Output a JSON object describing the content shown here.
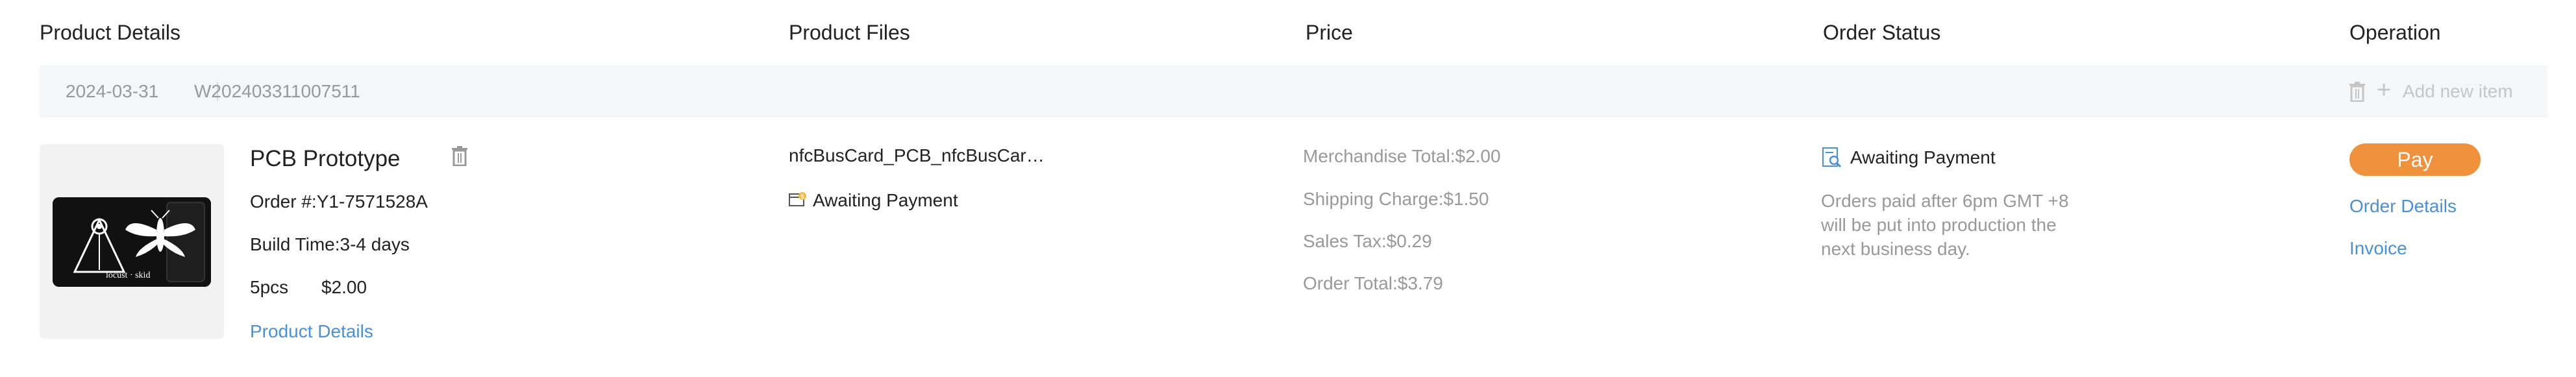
{
  "header": {
    "product_details": "Product Details",
    "product_files": "Product Files",
    "price": "Price",
    "order_status": "Order Status",
    "operation": "Operation"
  },
  "order": {
    "date": "2024-03-31",
    "number": "W202403311007511",
    "add_item_label": "Add new item"
  },
  "product": {
    "name": "PCB Prototype",
    "order_no": "Order #:Y1-7571528A",
    "build_time": "Build Time:3-4 days",
    "quantity": "5pcs",
    "unit_price": "$2.00",
    "details_link": "Product Details",
    "card_caption": "locust · skid"
  },
  "files": {
    "file_name": "nfcBusCard_PCB_nfcBusCar…",
    "status": "Awaiting Payment"
  },
  "price": {
    "merchandise": "Merchandise Total:$2.00",
    "shipping": "Shipping Charge:$1.50",
    "tax": "Sales Tax:$0.29",
    "total": "Order Total:$3.79"
  },
  "status": {
    "label": "Awaiting Payment",
    "note": "Orders paid after 6pm GMT +8 will be put into production the next business day."
  },
  "operation": {
    "pay": "Pay",
    "order_details": "Order Details",
    "invoice": "Invoice"
  },
  "colors": {
    "accent_orange": "#f0913b",
    "link_blue": "#4a90d9",
    "muted_gray": "#999999",
    "bar_bg": "#f5f6f7"
  },
  "icons": {
    "delete": "trash-icon",
    "add": "plus-icon",
    "file_status": "file-status-icon",
    "order_status": "search-document-icon"
  }
}
